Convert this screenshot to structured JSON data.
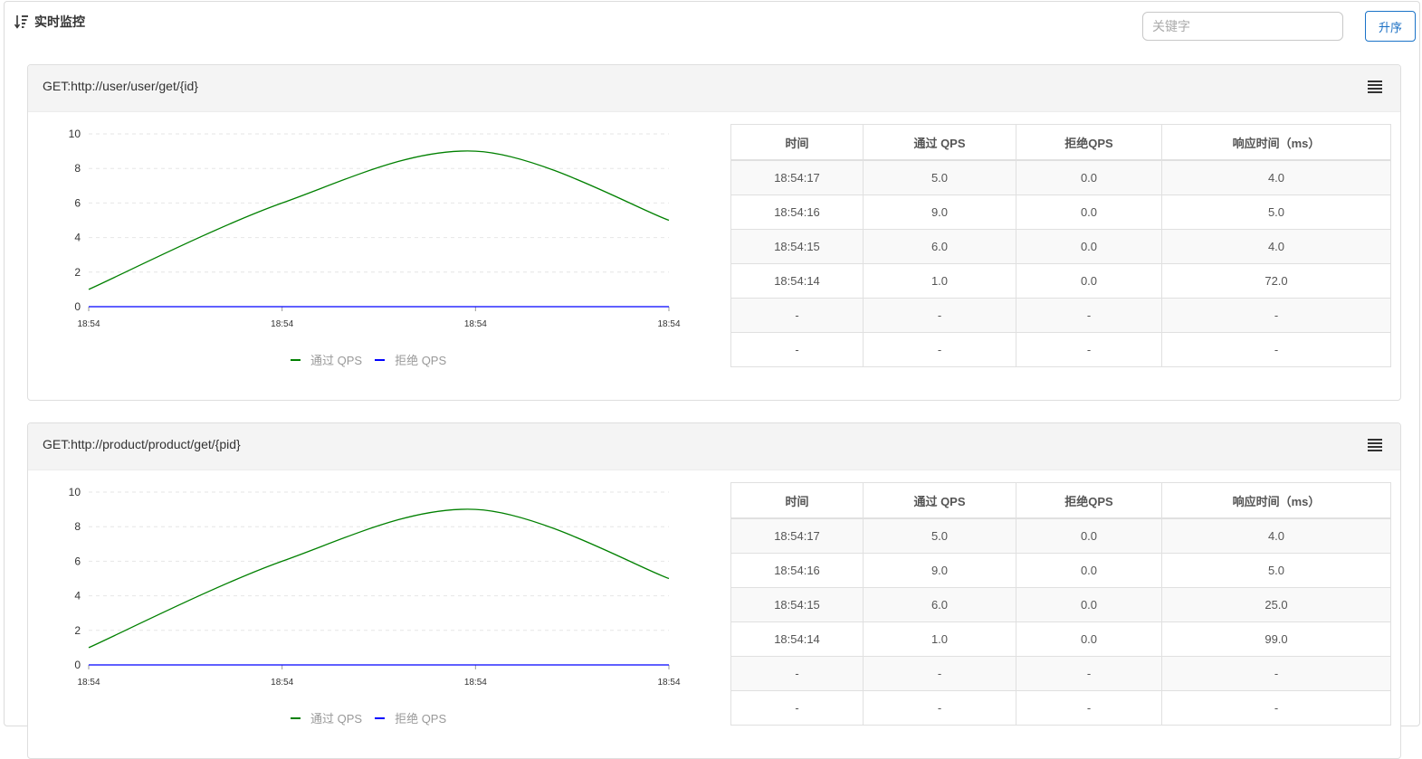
{
  "page": {
    "title": "实时监控",
    "search_placeholder": "关键字",
    "sort_button_label": "升序"
  },
  "table_headers": [
    "时间",
    "通过 QPS",
    "拒绝QPS",
    "响应时间（ms）"
  ],
  "panels": [
    {
      "title": "GET:http://user/user/get/{id}",
      "menu_icon": "menu-icon",
      "rows": [
        [
          "18:54:17",
          "5.0",
          "0.0",
          "4.0"
        ],
        [
          "18:54:16",
          "9.0",
          "0.0",
          "5.0"
        ],
        [
          "18:54:15",
          "6.0",
          "0.0",
          "4.0"
        ],
        [
          "18:54:14",
          "1.0",
          "0.0",
          "72.0"
        ],
        [
          "-",
          "-",
          "-",
          "-"
        ],
        [
          "-",
          "-",
          "-",
          "-"
        ]
      ]
    },
    {
      "title": "GET:http://product/product/get/{pid}",
      "menu_icon": "menu-icon",
      "rows": [
        [
          "18:54:17",
          "5.0",
          "0.0",
          "4.0"
        ],
        [
          "18:54:16",
          "9.0",
          "0.0",
          "5.0"
        ],
        [
          "18:54:15",
          "6.0",
          "0.0",
          "25.0"
        ],
        [
          "18:54:14",
          "1.0",
          "0.0",
          "99.0"
        ],
        [
          "-",
          "-",
          "-",
          "-"
        ],
        [
          "-",
          "-",
          "-",
          "-"
        ]
      ]
    }
  ],
  "chart_data": [
    {
      "type": "line",
      "x": [
        "18:54",
        "18:54",
        "18:54",
        "18:54"
      ],
      "series": [
        {
          "name": "通过 QPS",
          "values": [
            1,
            6,
            9,
            5
          ],
          "color": "#008000"
        },
        {
          "name": "拒绝 QPS",
          "values": [
            0,
            0,
            0,
            0
          ],
          "color": "#0000ff"
        }
      ],
      "yticks": [
        0,
        2,
        4,
        6,
        8,
        10
      ],
      "ylim": [
        0,
        10
      ],
      "grid": true,
      "legend": "bottom"
    },
    {
      "type": "line",
      "x": [
        "18:54",
        "18:54",
        "18:54",
        "18:54"
      ],
      "series": [
        {
          "name": "通过 QPS",
          "values": [
            1,
            6,
            9,
            5
          ],
          "color": "#008000"
        },
        {
          "name": "拒绝 QPS",
          "values": [
            0,
            0,
            0,
            0
          ],
          "color": "#0000ff"
        }
      ],
      "yticks": [
        0,
        2,
        4,
        6,
        8,
        10
      ],
      "ylim": [
        0,
        10
      ],
      "grid": true,
      "legend": "bottom"
    }
  ]
}
